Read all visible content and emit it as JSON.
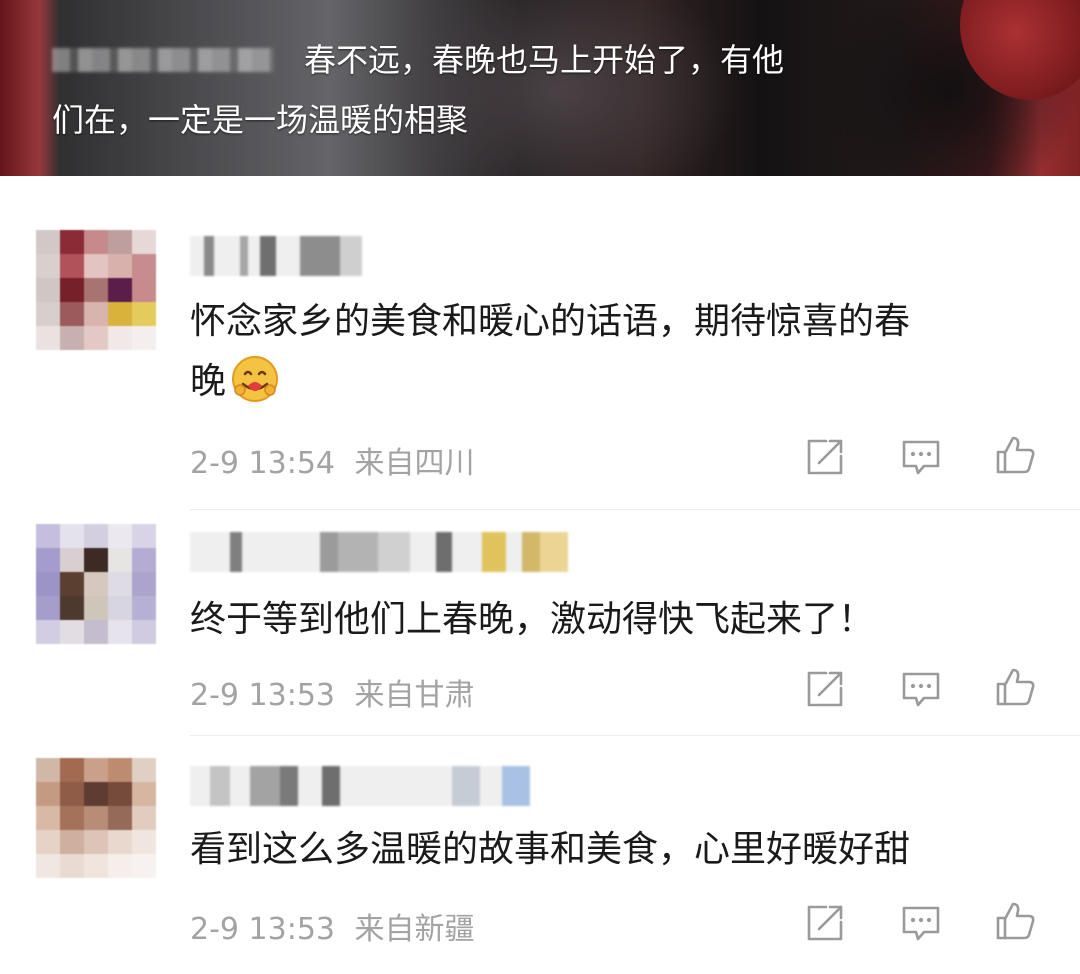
{
  "video": {
    "subtitle_line1": "春不远，春晚也马上开始了，有他",
    "subtitle_line2": "们在，一定是一场温暖的相聚"
  },
  "comments": [
    {
      "text": "怀念家乡的美食和暖心的话语，期待惊喜的春晚",
      "text_line1": "怀念家乡的美食和暖心的话语，期待惊喜的春",
      "text_line2": "晚",
      "emoji": "hug-emoji",
      "time": "2-9 13:54",
      "location": "来自四川",
      "actions": [
        "share-icon",
        "comment-icon",
        "like-icon"
      ]
    },
    {
      "text": "终于等到他们上春晚，激动得快飞起来了！",
      "time": "2-9 13:53",
      "location": "来自甘肃",
      "actions": [
        "share-icon",
        "comment-icon",
        "like-icon"
      ]
    },
    {
      "text": "看到这么多温暖的故事和美食，心里好暖好甜",
      "time": "2-9 13:53",
      "location": "来自新疆",
      "actions": [
        "share-icon",
        "comment-icon",
        "like-icon"
      ]
    }
  ],
  "colors": {
    "text": "#1a1a1a",
    "meta": "#a3a3a3",
    "icon": "#9a9a9a",
    "divider": "#ececec"
  }
}
